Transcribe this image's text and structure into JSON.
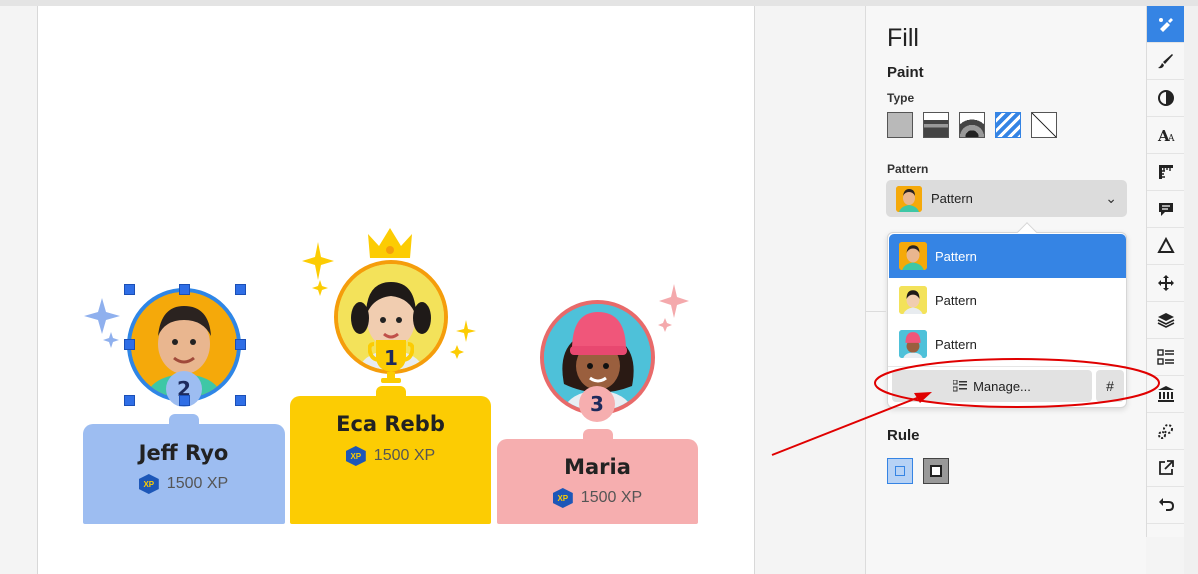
{
  "podium": {
    "second": {
      "rank": "2",
      "name": "Jeff Ryo",
      "xp": "1500 XP",
      "badge": "XP"
    },
    "first": {
      "rank": "1",
      "name": "Eca Rebb",
      "xp": "1500 XP",
      "badge": "XP"
    },
    "third": {
      "rank": "3",
      "name": "Maria",
      "xp": "1500 XP",
      "badge": "XP"
    }
  },
  "panel": {
    "title": "Fill",
    "paint_heading": "Paint",
    "type_label": "Type",
    "type_options": [
      "flat-color-icon",
      "linear-gradient-icon",
      "radial-gradient-icon",
      "pattern-icon",
      "none-icon"
    ],
    "selected_type": "pattern-icon",
    "pattern_label": "Pattern",
    "dropdown": {
      "value": "Pattern"
    },
    "options": [
      {
        "label": "Pattern"
      },
      {
        "label": "Pattern"
      },
      {
        "label": "Pattern"
      }
    ],
    "manage_label": "Manage...",
    "hash_label": "#",
    "rule_heading": "Rule"
  },
  "sidebar": {
    "icons": [
      "fill-bucket-icon",
      "stroke-brush-icon",
      "opacity-icon",
      "text-icon",
      "ruler-icon",
      "comment-icon",
      "triangle-icon",
      "move-icon",
      "layers-icon",
      "list-icon",
      "museum-icon",
      "sparkles-icon",
      "export-icon",
      "undo-icon"
    ]
  },
  "colors": {
    "accent": "#3584e4",
    "podium_blue": "#9dbdf1",
    "podium_yellow": "#fccc03",
    "podium_pink": "#f6aeaf",
    "annotation_red": "#e00000"
  }
}
